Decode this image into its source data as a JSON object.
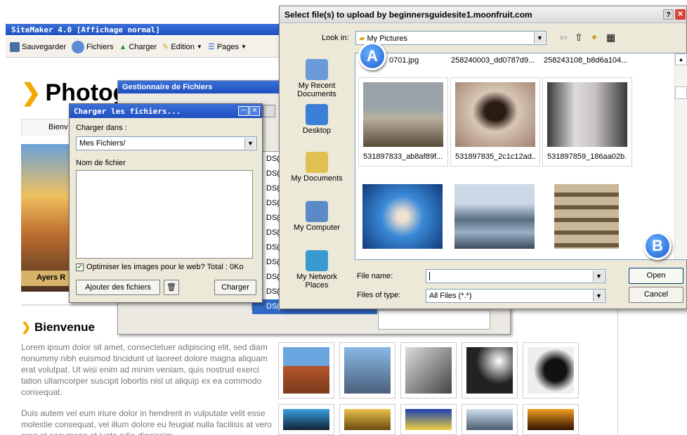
{
  "sitemaker": {
    "title": "SiteMaker 4.0  [Affichage normal]",
    "toolbar": {
      "save": "Sauvegarder",
      "files": "Fichiers",
      "upload": "Charger",
      "edit": "Edition",
      "pages": "Pages"
    },
    "page_title": "Photogr",
    "nav_tab": "Bienv",
    "hero_caption": "Ayers R",
    "section_title": "Bienvenue",
    "para1": "Lorem ipsum dolor sit amet, consectetuer adipiscing elit, sed diam nonummy nibh euismod tincidunt ut laoreet dolore magna aliquam erat volutpat. Ut wisi enim ad minim veniam, quis nostrud exerci tation ullamcorper suscipit lobortis nisl ut aliquip ex ea commodo consequat.",
    "para2": "Duis autem vel eum iriure dolor in hendrerit in vulputate velit esse molestie consequat, vel illum dolore eu feugiat nulla facilisis at vero eros et accumsan et iusto odio dignissim"
  },
  "gestionnaire": {
    "title": "Gestionnaire de Fichiers",
    "rows": [
      "DS(",
      "DS(",
      "DS(",
      "DS(",
      "DS(",
      "DS(",
      "DS(",
      "DS(",
      "DS(",
      "DS(",
      "DS("
    ]
  },
  "charger": {
    "title": "Charger les fichiers...",
    "folder_label": "Charger dans :",
    "folder_value": "Mes Fichiers/",
    "filename_label": "Nom de fichier",
    "optimize_label": "Optimiser les images pour le web? Total : 0Ko",
    "add_button": "Ajouter des fichiers",
    "upload_button": "Charger"
  },
  "dialog": {
    "title": "Select file(s) to upload by beginnersguidesite1.moonfruit.com",
    "look_in_label": "Look in:",
    "look_in_value": "My Pictures",
    "places": [
      {
        "label": "My Recent Documents",
        "icon": "recent-documents-icon"
      },
      {
        "label": "Desktop",
        "icon": "desktop-icon"
      },
      {
        "label": "My Documents",
        "icon": "my-documents-icon"
      },
      {
        "label": "My Computer",
        "icon": "my-computer-icon"
      },
      {
        "label": "My Network Places",
        "icon": "network-places-icon"
      }
    ],
    "top_row_files": [
      "0701.jpg",
      "258240003_dd0787d9...",
      "258243108_b8d6a104..."
    ],
    "files": [
      "531897833_ab8af89f...",
      "531897835_2c1c12ad...",
      "531897859_186aa02b..."
    ],
    "file_name_label": "File name:",
    "file_name_value": "",
    "file_type_label": "Files of type:",
    "file_type_value": "All Files (*.*)",
    "open_button": "Open",
    "cancel_button": "Cancel"
  },
  "markers": {
    "a": "A",
    "b": "B"
  }
}
